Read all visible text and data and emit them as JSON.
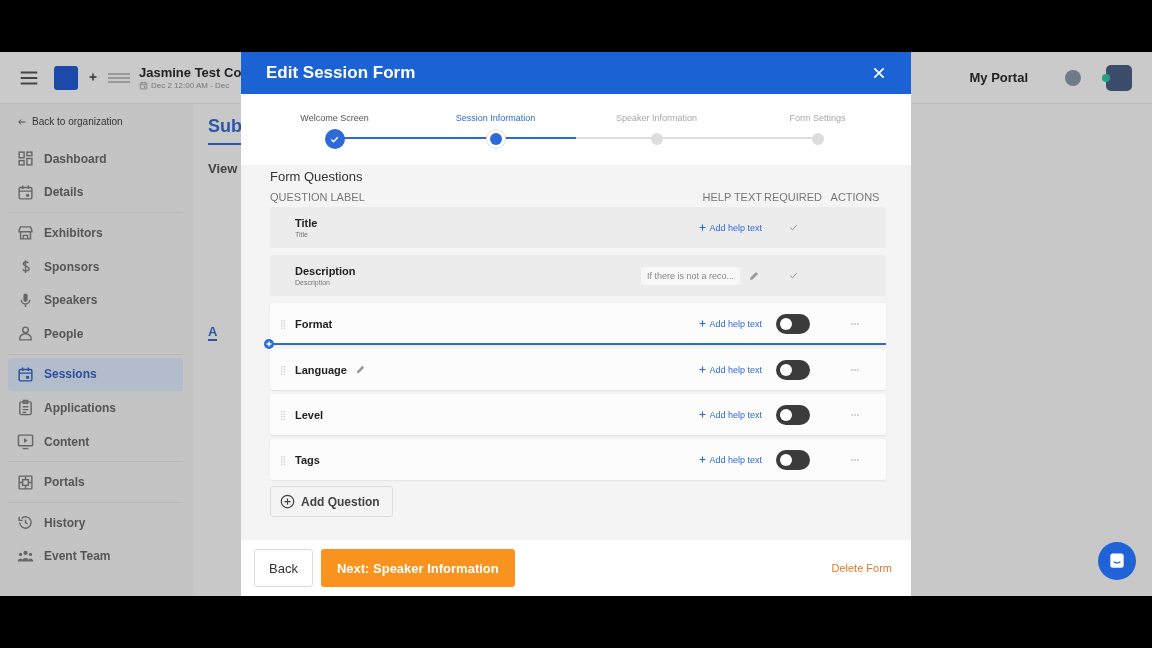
{
  "topbar": {
    "event_title": "Jasmine Test Co",
    "event_dates": "Dec 2 12:00 AM - Dec",
    "portal_link": "My Portal"
  },
  "sidebar": {
    "back_link": "Back to organization",
    "groups": [
      [
        {
          "label": "Dashboard",
          "selected": false
        },
        {
          "label": "Details",
          "selected": false
        }
      ],
      [
        {
          "label": "Exhibitors",
          "selected": false
        },
        {
          "label": "Sponsors",
          "selected": false
        },
        {
          "label": "Speakers",
          "selected": false
        },
        {
          "label": "People",
          "selected": false
        }
      ],
      [
        {
          "label": "Sessions",
          "selected": true
        },
        {
          "label": "Applications",
          "selected": false
        },
        {
          "label": "Content",
          "selected": false
        }
      ],
      [
        {
          "label": "Portals",
          "selected": false
        }
      ],
      [
        {
          "label": "History",
          "selected": false
        },
        {
          "label": "Event Team",
          "selected": false
        }
      ]
    ]
  },
  "page": {
    "title": "Sub",
    "subtab": "View",
    "tab": "A"
  },
  "modal": {
    "title": "Edit Session Form",
    "steps": [
      {
        "label": "Welcome Screen",
        "completed": true,
        "selected": false
      },
      {
        "label": "Session Information",
        "completed": false,
        "selected": true
      },
      {
        "label": "Speaker Information",
        "completed": false,
        "selected": false
      },
      {
        "label": "Form Settings",
        "completed": false,
        "selected": false
      }
    ],
    "section_title": "Form Questions",
    "columns": [
      "QUESTION LABEL",
      "HELP TEXT",
      "REQUIRED",
      "ACTIONS"
    ],
    "questions": [
      {
        "kind": "fixed",
        "label": "Title",
        "sublabel": "Title",
        "help_link": "Add help text",
        "required": true
      },
      {
        "kind": "fixed",
        "label": "Description",
        "sublabel": "Description",
        "help_text": "If there is not a reco...",
        "required": true
      },
      {
        "kind": "custom",
        "label": "Format",
        "help_link": "Add help text",
        "required": false,
        "editing": false,
        "drop_line_below": true
      },
      {
        "kind": "custom",
        "label": "Language",
        "help_link": "Add help text",
        "required": false,
        "editing": true,
        "drop_line_below": false
      },
      {
        "kind": "custom",
        "label": "Level",
        "help_link": "Add help text",
        "required": false,
        "editing": false,
        "drop_line_below": false
      },
      {
        "kind": "custom",
        "label": "Tags",
        "help_link": "Add help text",
        "required": false,
        "editing": false,
        "drop_line_below": false
      }
    ],
    "add_button": "Add Question",
    "back_button": "Back",
    "next_button": "Next: Speaker Information",
    "delete_link": "Delete Form"
  }
}
